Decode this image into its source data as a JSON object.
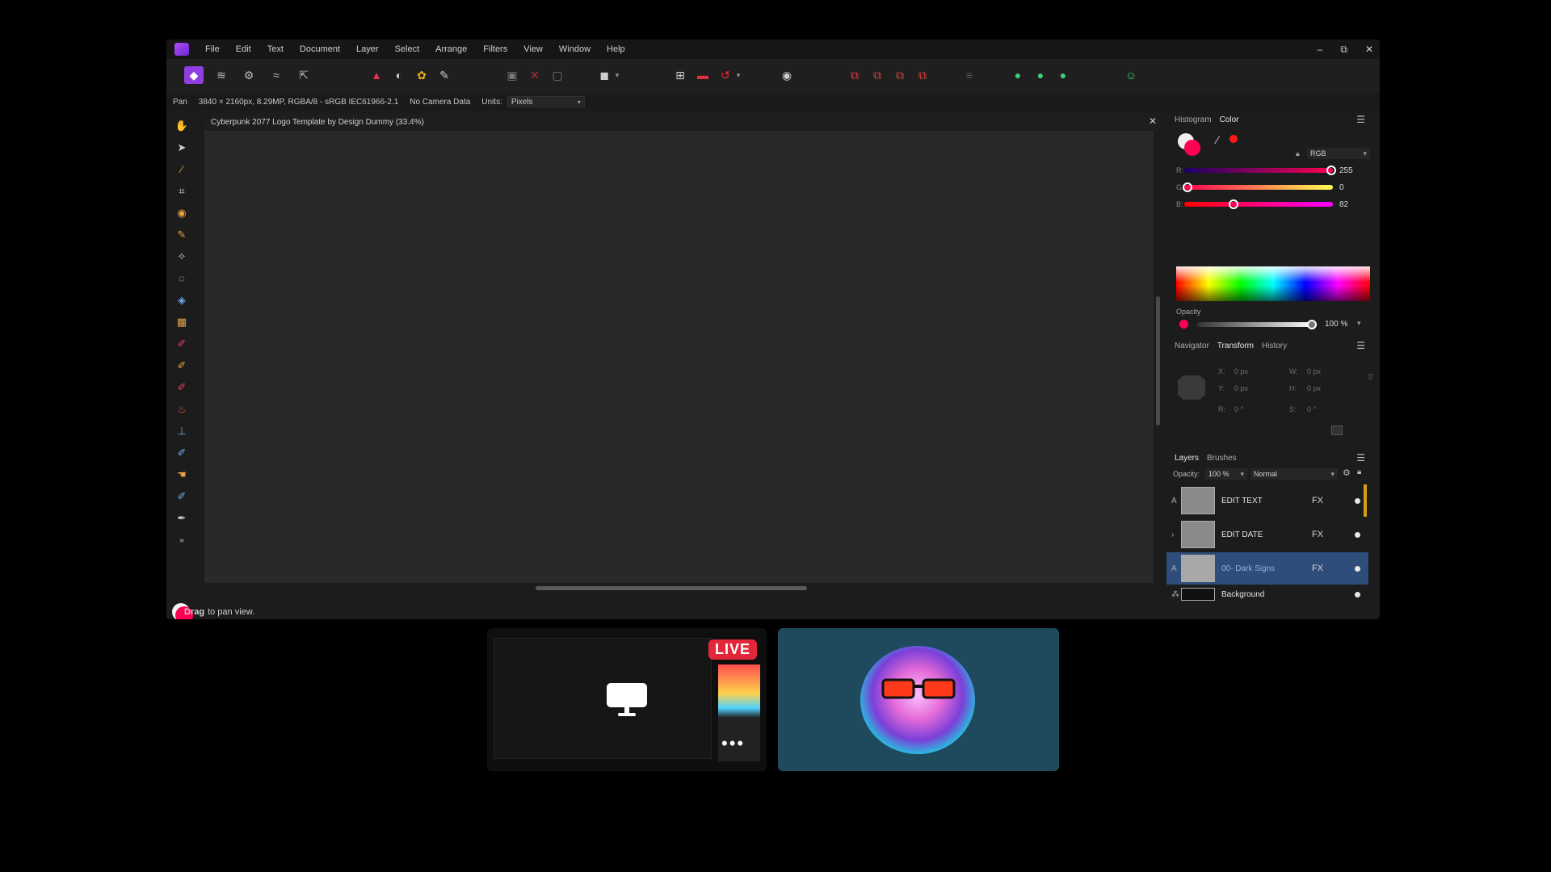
{
  "menubar": {
    "items": [
      "File",
      "Edit",
      "Text",
      "Document",
      "Layer",
      "Select",
      "Arrange",
      "Filters",
      "View",
      "Window",
      "Help"
    ]
  },
  "window_controls": {
    "minimize": "–",
    "maximize": "⧉",
    "close": "✕"
  },
  "context": {
    "tool": "Pan",
    "doc_info": "3840 × 2160px, 8.29MP, RGBA/8 - sRGB IEC61966-2.1",
    "camera": "No Camera Data",
    "units_label": "Units:",
    "units_value": "Pixels"
  },
  "document": {
    "title": "Cyberpunk 2077 Logo Template by Design Dummy (33.4%)",
    "close": "✕"
  },
  "status": {
    "bold": "Drag",
    "text": "to pan view."
  },
  "color_panel": {
    "tabs": [
      "Histogram",
      "Color"
    ],
    "active_tab": "Color",
    "mode": "RGB",
    "r_label": "R:",
    "g_label": "G:",
    "b_label": "B:",
    "r": 255,
    "g": 0,
    "b": 82,
    "opacity_label": "Opacity",
    "opacity_value": "100 %",
    "primary_color": "#ff0052"
  },
  "transform_panel": {
    "tabs": [
      "Navigator",
      "Transform",
      "History"
    ],
    "active_tab": "Transform",
    "x_label": "X:",
    "x_value": "0 px",
    "y_label": "Y:",
    "y_value": "0 px",
    "w_label": "W:",
    "w_value": "0 px",
    "h_label": "H:",
    "h_value": "0 px",
    "r_label": "R:",
    "r_value": "0 °",
    "s_label": "S:",
    "s_value": "0 °"
  },
  "layers_panel": {
    "tabs": [
      "Layers",
      "Brushes"
    ],
    "active_tab": "Layers",
    "opacity_label": "Opacity:",
    "opacity_value": "100 %",
    "blend_mode": "Normal",
    "layers": [
      {
        "name": "EDIT TEXT",
        "fx": "FX",
        "selected": false
      },
      {
        "name": "EDIT DATE",
        "fx": "FX",
        "selected": false
      },
      {
        "name": "00- Dark Signs",
        "fx": "FX",
        "selected": true
      },
      {
        "name": "Background",
        "fx": "",
        "selected": false
      }
    ]
  },
  "stream": {
    "live_label": "LIVE",
    "more": "•••"
  },
  "colors": {
    "accent": "#ff0052",
    "selected_layer": "#2f4d7a",
    "live": "#e0283a",
    "avatar_bg": "#1f4a5e"
  }
}
